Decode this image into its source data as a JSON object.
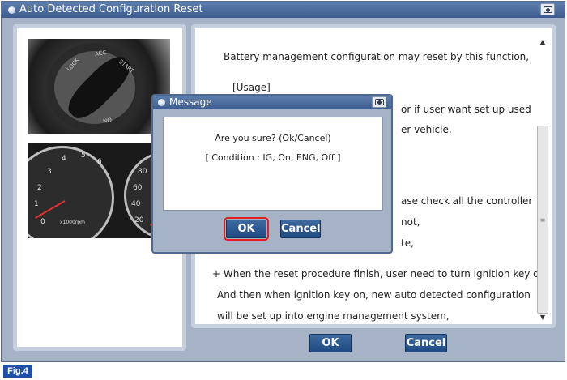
{
  "window": {
    "title": "Auto Detected Configuration Reset"
  },
  "photos": {
    "switch_labels": [
      "LOCK",
      "ACC",
      "START",
      "ON"
    ],
    "gauge_numbers_left": [
      "6",
      "5",
      "4",
      "3",
      "2",
      "1",
      "0"
    ],
    "gauge_numbers_right": [
      "80",
      "60",
      "40",
      "20"
    ],
    "gauge_unit": "x1000rpm"
  },
  "content": {
    "lines": [
      "Battery management configuration may reset by this function,",
      "[Usage]",
      "or if user want set up used",
      "er vehicle,",
      "ase check all the controller",
      "not,",
      "te,",
      "+ When the reset procedure finish, user need to turn ignition key off,",
      "And then when ignition key on, new auto detected configuration",
      "will be set up into engine management system,"
    ]
  },
  "buttons": {
    "ok": "OK",
    "cancel": "Cancel"
  },
  "dialog": {
    "title": "Message",
    "message": "Are you sure? (Ok/Cancel)",
    "condition": "[ Condition : IG, On, ENG, Off ]",
    "ok": "OK",
    "cancel": "Cancel"
  },
  "figure_label": "Fig.4",
  "colors": {
    "titlebar": "#3d5c8d",
    "button": "#1f4a82",
    "highlight": "#e02020",
    "figure_label": "#1f4fa8"
  }
}
